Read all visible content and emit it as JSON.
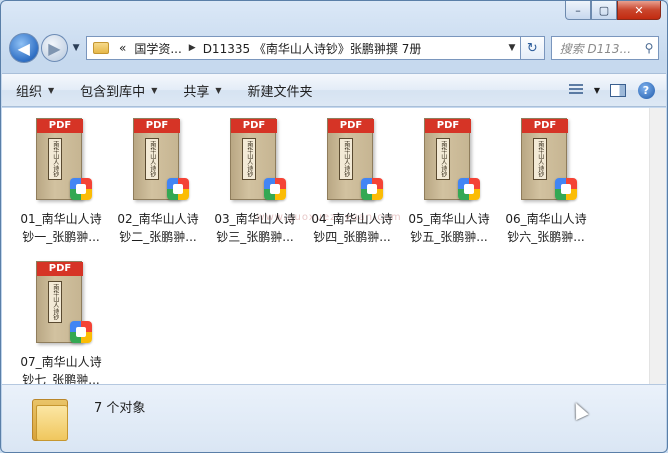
{
  "window": {
    "minimize_label": "–",
    "maximize_label": "▢",
    "close_label": "✕"
  },
  "nav": {
    "back_icon": "◀",
    "forward_icon": "▶",
    "history_icon": "▼",
    "address": {
      "overflow": "«",
      "crumbs": [
        "国学资...",
        "D11335 《南华山人诗钞》张鹏翀撰 7册"
      ],
      "separator": "▶",
      "dropdown": "▼"
    },
    "refresh_icon": "↻",
    "search_placeholder": "搜索 D113...",
    "search_icon": "⚲"
  },
  "toolbar": {
    "organize": "组织",
    "include_library": "包含到库中",
    "share": "共享",
    "new_folder": "新建文件夹",
    "arrow": "▼",
    "help": "?"
  },
  "files": [
    {
      "badge": "PDF",
      "spine": "南华山人诗钞",
      "name": "01_南华山人诗钞一_张鹏翀..."
    },
    {
      "badge": "PDF",
      "spine": "南华山人诗钞",
      "name": "02_南华山人诗钞二_张鹏翀..."
    },
    {
      "badge": "PDF",
      "spine": "南华山人诗钞",
      "name": "03_南华山人诗钞三_张鹏翀..."
    },
    {
      "badge": "PDF",
      "spine": "南华山人诗钞",
      "name": "04_南华山人诗钞四_张鹏翀..."
    },
    {
      "badge": "PDF",
      "spine": "南华山人诗钞",
      "name": "05_南华山人诗钞五_张鹏翀..."
    },
    {
      "badge": "PDF",
      "spine": "南华山人诗钞",
      "name": "06_南华山人诗钞六_张鹏翀..."
    },
    {
      "badge": "PDF",
      "spine": "南华山人诗钞",
      "name": "07_南华山人诗钞七_张鹏翀..."
    }
  ],
  "watermark": "www.guoxuezi yuan.com",
  "status": {
    "count": "7 个对象"
  }
}
